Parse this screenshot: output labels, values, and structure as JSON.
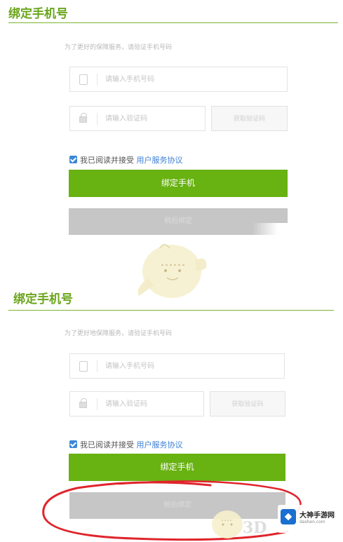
{
  "sections": [
    {
      "title": "绑定手机号",
      "hint": "为了更好的保障服务，请验证手机号码",
      "phone_placeholder": "请输入手机号码",
      "code_placeholder": "请输入验证码",
      "code_button": "获取验证码",
      "agree_text": "我已阅读并接受 ",
      "agree_link": "用户服务协议",
      "primary_button": "绑定手机",
      "secondary_button": "稍后绑定"
    },
    {
      "title": "绑定手机号",
      "hint": "为了更好地保障服务，请验证手机号码",
      "phone_placeholder": "请输入手机号码",
      "code_placeholder": "请输入验证码",
      "code_button": "获取验证码",
      "agree_text": "我已阅读并接受 ",
      "agree_link": "用户服务协议",
      "primary_button": "绑定手机",
      "secondary_button": "稍后绑定"
    }
  ],
  "watermark": {
    "site_name": "大神手游网",
    "site_url": "dashen.com",
    "mark_3d": "3D"
  },
  "colors": {
    "accent_green": "#68b212",
    "title_green": "#6aa51b",
    "link_blue": "#3b7fd4",
    "checkbox_blue": "#3d87d8",
    "disabled_gray": "#c6c6c6",
    "annotation_red": "#e0242b"
  }
}
